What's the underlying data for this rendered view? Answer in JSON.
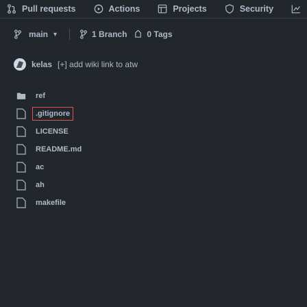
{
  "topnav": {
    "items": [
      {
        "label": "Pull requests",
        "icon": "pull-request-icon"
      },
      {
        "label": "Actions",
        "icon": "play-circle-icon"
      },
      {
        "label": "Projects",
        "icon": "table-icon"
      },
      {
        "label": "Security",
        "icon": "shield-icon"
      },
      {
        "label": "",
        "icon": "graph-icon"
      }
    ]
  },
  "branchbar": {
    "branch": "main",
    "branches": "1 Branch",
    "tags": "0 Tags"
  },
  "commit": {
    "author": "kelas",
    "message": "[+] add wiki link to atw"
  },
  "files": [
    {
      "name": "ref",
      "type": "folder"
    },
    {
      "name": ".gitignore",
      "type": "file",
      "highlighted": true
    },
    {
      "name": "LICENSE",
      "type": "file"
    },
    {
      "name": "README.md",
      "type": "file"
    },
    {
      "name": "ac",
      "type": "file"
    },
    {
      "name": "ah",
      "type": "file"
    },
    {
      "name": "makefile",
      "type": "file"
    }
  ],
  "colors": {
    "background": "#22272e",
    "text": "#adbac7",
    "highlight": "#e5534b"
  }
}
